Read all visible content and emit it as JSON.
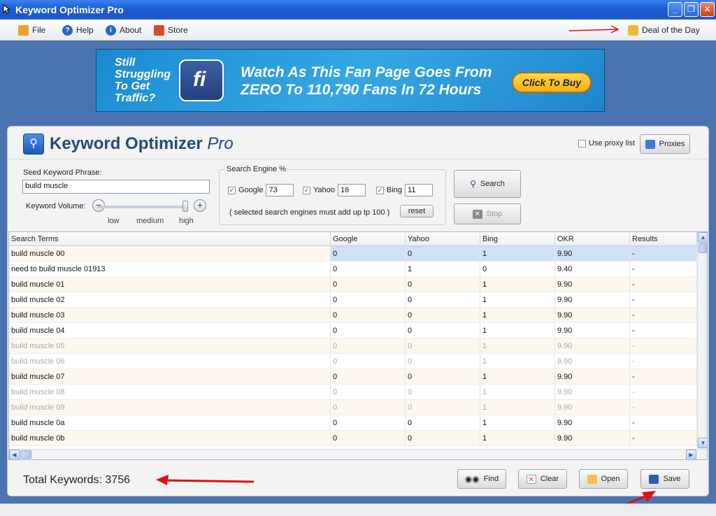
{
  "window": {
    "title": "Keyword Optimizer Pro",
    "minimize_glyph": "_",
    "maximize_glyph": "❐",
    "close_glyph": "✕"
  },
  "menu": {
    "items": [
      {
        "label": "File",
        "icon": "file-icon"
      },
      {
        "label": "Help",
        "icon": "help-icon"
      },
      {
        "label": "About",
        "icon": "about-icon"
      },
      {
        "label": "Store",
        "icon": "store-icon"
      }
    ],
    "deal": "Deal of the Day"
  },
  "banner": {
    "left_text": [
      "Still",
      "Struggling",
      "To Get",
      "Traffic?"
    ],
    "logo_text": "fi",
    "headline": [
      "Watch As This Fan Page Goes From",
      "ZERO To 110,790 Fans In 72 Hours"
    ],
    "cta": "Click To Buy"
  },
  "app": {
    "name": "Keyword Optimizer",
    "name_suffix": "Pro",
    "use_proxy_label": "Use proxy list",
    "use_proxy_checked": false,
    "proxies_label": "Proxies"
  },
  "seed": {
    "label": "Seed Keyword Phrase:",
    "value": "build muscle",
    "volume_label": "Keyword Volume:",
    "minus": "−",
    "plus": "+",
    "ticks": [
      "low",
      "medium",
      "high"
    ],
    "volume_level": "high"
  },
  "engines": {
    "legend": "Search Engine %",
    "items": [
      {
        "name": "Google",
        "value": "73",
        "checked": true
      },
      {
        "name": "Yahoo",
        "value": "16",
        "checked": true
      },
      {
        "name": "Bing",
        "value": "11",
        "checked": true
      }
    ],
    "note": "( selected search engines must add up tp 100 )",
    "reset": "reset"
  },
  "actions": {
    "search": "Search",
    "stop": "Stop"
  },
  "table": {
    "columns": [
      "Search Terms",
      "Google",
      "Yahoo",
      "Bing",
      "OKR",
      "Results"
    ],
    "rows": [
      {
        "term": "build muscle 00",
        "google": "0",
        "yahoo": "0",
        "bing": "1",
        "okr": "9.90",
        "results": "-",
        "faded": false,
        "selected": true
      },
      {
        "term": "need to build muscle 01913",
        "google": "0",
        "yahoo": "1",
        "bing": "0",
        "okr": "9.40",
        "results": "-",
        "faded": false,
        "selected": false
      },
      {
        "term": "build muscle 01",
        "google": "0",
        "yahoo": "0",
        "bing": "1",
        "okr": "9.90",
        "results": "-",
        "faded": false,
        "selected": false
      },
      {
        "term": "build muscle 02",
        "google": "0",
        "yahoo": "0",
        "bing": "1",
        "okr": "9.90",
        "results": "-",
        "faded": false,
        "selected": false
      },
      {
        "term": "build muscle 03",
        "google": "0",
        "yahoo": "0",
        "bing": "1",
        "okr": "9.90",
        "results": "-",
        "faded": false,
        "selected": false
      },
      {
        "term": "build muscle 04",
        "google": "0",
        "yahoo": "0",
        "bing": "1",
        "okr": "9.90",
        "results": "-",
        "faded": false,
        "selected": false
      },
      {
        "term": "build muscle 05",
        "google": "0",
        "yahoo": "0",
        "bing": "1",
        "okr": "9.90",
        "results": "-",
        "faded": true,
        "selected": false
      },
      {
        "term": "build muscle 06",
        "google": "0",
        "yahoo": "0",
        "bing": "1",
        "okr": "9.90",
        "results": "-",
        "faded": true,
        "selected": false
      },
      {
        "term": "build muscle 07",
        "google": "0",
        "yahoo": "0",
        "bing": "1",
        "okr": "9.90",
        "results": "-",
        "faded": false,
        "selected": false
      },
      {
        "term": "build muscle 08",
        "google": "0",
        "yahoo": "0",
        "bing": "1",
        "okr": "9.90",
        "results": "-",
        "faded": true,
        "selected": false
      },
      {
        "term": "build muscle 09",
        "google": "0",
        "yahoo": "0",
        "bing": "1",
        "okr": "9.90",
        "results": "-",
        "faded": true,
        "selected": false
      },
      {
        "term": "build muscle 0a",
        "google": "0",
        "yahoo": "0",
        "bing": "1",
        "okr": "9.90",
        "results": "-",
        "faded": false,
        "selected": false
      },
      {
        "term": "build muscle 0b",
        "google": "0",
        "yahoo": "0",
        "bing": "1",
        "okr": "9.90",
        "results": "-",
        "faded": false,
        "selected": false
      }
    ]
  },
  "footer": {
    "total_label": "Total Keywords:",
    "total_value": "3756",
    "find": "Find",
    "clear": "Clear",
    "open": "Open",
    "save": "Save"
  },
  "colors": {
    "titlebar": "#1f5fd8",
    "annotation_red": "#e01010",
    "selection": "#cfe1f6",
    "alt_row": "#fdf7ee",
    "app_title": "#254a77"
  }
}
